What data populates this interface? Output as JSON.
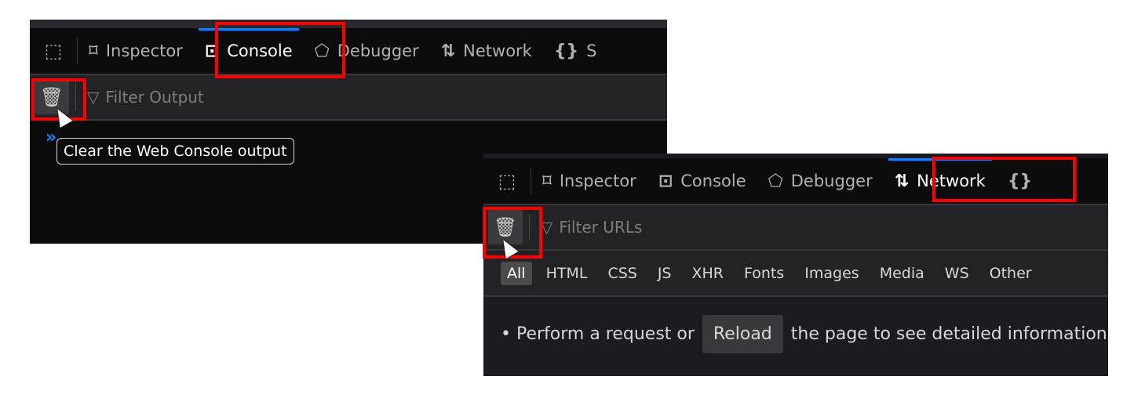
{
  "console_panel": {
    "tabs": [
      {
        "label": "Inspector",
        "icon": "inspector-icon"
      },
      {
        "label": "Console",
        "icon": "console-icon",
        "selected": true
      },
      {
        "label": "Debugger",
        "icon": "debugger-icon"
      },
      {
        "label": "Network",
        "icon": "network-icon"
      },
      {
        "label": "S",
        "icon": "style-editor-icon"
      }
    ],
    "filter_placeholder": "Filter Output",
    "tooltip": "Clear the Web Console output"
  },
  "network_panel": {
    "tabs": [
      {
        "label": "Inspector",
        "icon": "inspector-icon"
      },
      {
        "label": "Console",
        "icon": "console-icon"
      },
      {
        "label": "Debugger",
        "icon": "debugger-icon"
      },
      {
        "label": "Network",
        "icon": "network-icon",
        "selected": true
      },
      {
        "label": "",
        "icon": "style-editor-icon"
      }
    ],
    "filter_placeholder": "Filter URLs",
    "types": [
      "All",
      "HTML",
      "CSS",
      "JS",
      "XHR",
      "Fonts",
      "Images",
      "Media",
      "WS",
      "Other"
    ],
    "message_before": "• Perform a request or",
    "reload_label": "Reload",
    "message_after": "the page to see detailed information about network activity."
  },
  "colors": {
    "highlight": "#ff0000",
    "accent": "#0a84ff"
  }
}
